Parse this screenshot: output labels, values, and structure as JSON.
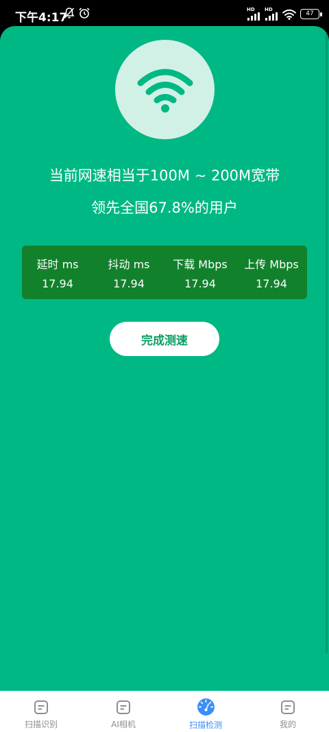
{
  "status_bar": {
    "time": "下午4:17",
    "signal_badge_1": "HD",
    "signal_badge_2": "HD",
    "battery": "47"
  },
  "result": {
    "headline": "当前网速相当于100M ~ 200M宽带",
    "subline": "领先全国67.8%的用户"
  },
  "stats": [
    {
      "label": "延时 ms",
      "value": "17.94"
    },
    {
      "label": "抖动 ms",
      "value": "17.94"
    },
    {
      "label": "下载 Mbps",
      "value": "17.94"
    },
    {
      "label": "上传 Mbps",
      "value": "17.94"
    }
  ],
  "done_button": "完成测速",
  "tabs": [
    {
      "label": "扫描识别",
      "icon": "document-icon",
      "active": false
    },
    {
      "label": "AI相机",
      "icon": "document-icon",
      "active": false
    },
    {
      "label": "扫描检测",
      "icon": "speedometer-icon",
      "active": true
    },
    {
      "label": "我的",
      "icon": "document-icon",
      "active": false
    }
  ],
  "colors": {
    "background": "#00B884",
    "stats_panel": "#12812C",
    "button_text": "#0A9E63",
    "tab_active": "#3A8EF6",
    "tab_inactive": "#8E8E8E"
  }
}
